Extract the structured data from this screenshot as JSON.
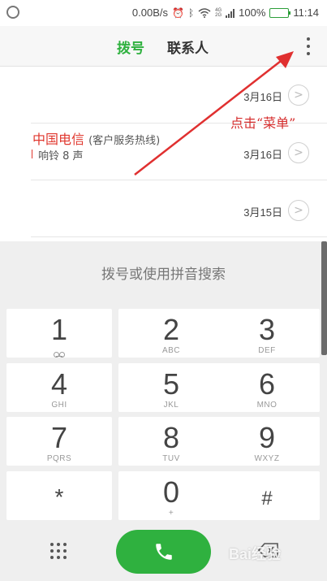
{
  "status_bar": {
    "network_speed": "0.00B/s",
    "network_type_top": "4G",
    "network_type_bottom": "2G",
    "battery": "100%",
    "time": "11:14",
    "icons": [
      "app-icon",
      "alarm-icon",
      "bluetooth-icon",
      "wifi-icon",
      "signal-icon",
      "battery-icon"
    ]
  },
  "header": {
    "tabs": [
      {
        "label": "拨号",
        "active": true
      },
      {
        "label": "联系人",
        "active": false
      }
    ],
    "menu_icon": "more-vertical-icon"
  },
  "call_log": [
    {
      "name": "",
      "subtitle": "",
      "detail": "",
      "date": "3月16日"
    },
    {
      "name": "",
      "subtitle": "",
      "detail": "",
      "date": "3月16日"
    },
    {
      "name": "中国电信",
      "subtitle": "(客户服务热线)",
      "detail": "响铃 8 声",
      "date": "3月15日"
    }
  ],
  "annotation": {
    "text": "点击“菜单”",
    "color": "#d62d2d"
  },
  "dialer": {
    "search_hint": "拨号或使用拼音搜索",
    "keys": [
      {
        "digit": "1",
        "letters": ""
      },
      {
        "digit": "2",
        "letters": "ABC"
      },
      {
        "digit": "3",
        "letters": "DEF"
      },
      {
        "digit": "4",
        "letters": "GHI"
      },
      {
        "digit": "5",
        "letters": "JKL"
      },
      {
        "digit": "6",
        "letters": "MNO"
      },
      {
        "digit": "7",
        "letters": "PQRS"
      },
      {
        "digit": "8",
        "letters": "TUV"
      },
      {
        "digit": "9",
        "letters": "WXYZ"
      },
      {
        "digit": "*",
        "letters": ""
      },
      {
        "digit": "0",
        "letters": "+"
      },
      {
        "digit": "#",
        "letters": ""
      }
    ]
  },
  "bottom_bar": {
    "keypad_icon": "keypad-grid-icon",
    "call_icon": "phone-icon",
    "delete_icon": "backspace-icon",
    "watermark": "Bai经验"
  },
  "colors": {
    "accent": "#2fb13f",
    "contact_name": "#e0382f",
    "arrow": "#e03030"
  }
}
